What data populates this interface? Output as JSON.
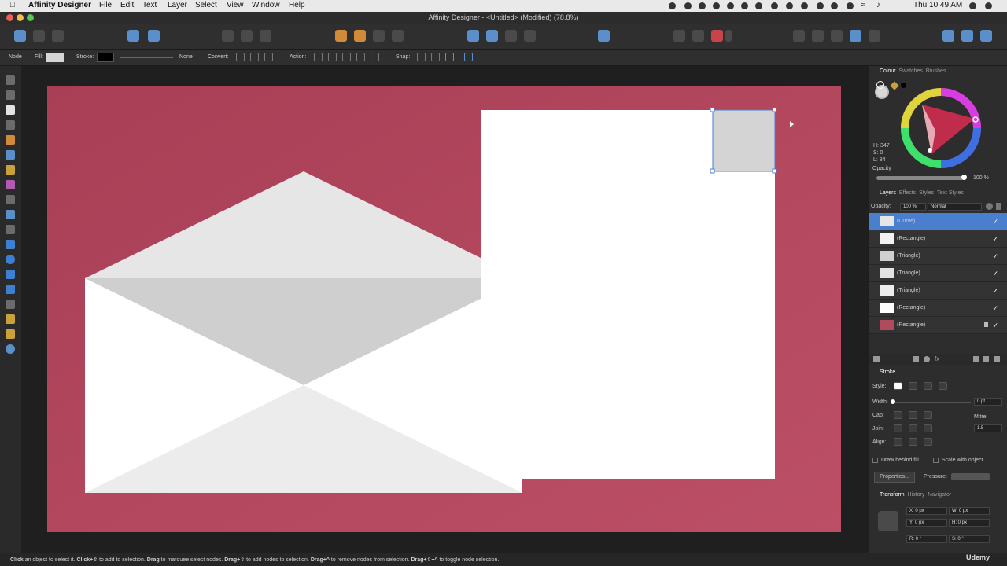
{
  "menubar": {
    "app_name": "Affinity Designer",
    "items": [
      "File",
      "Edit",
      "Text",
      "Layer",
      "Select",
      "View",
      "Window",
      "Help"
    ],
    "clock": "Thu 10:49 AM"
  },
  "window": {
    "title": "Affinity Designer - <Untitled> (Modified) (78.8%)"
  },
  "context_bar": {
    "mode": "Node",
    "fill_label": "Fill:",
    "stroke_label": "Stroke:",
    "stroke_value": "None",
    "convert_label": "Convert:",
    "action_label": "Action:",
    "snap_label": "Snap:"
  },
  "colour_panel": {
    "tabs": [
      "Colour",
      "Swatches",
      "Brushes"
    ],
    "h": "H: 347",
    "s": "S: 0",
    "l": "L: 84",
    "opacity_label": "Opacity",
    "opacity_value": "100 %"
  },
  "layers_panel": {
    "tabs": [
      "Layers",
      "Effects",
      "Styles",
      "Text Styles"
    ],
    "opacity_label": "Opacity:",
    "opacity_value": "100 %",
    "blend_mode": "Normal",
    "layers": [
      {
        "name": "(Curve)",
        "selected": true,
        "thumb": "#e6e6e6"
      },
      {
        "name": "(Rectangle)",
        "selected": false,
        "thumb": "#f2f2f2"
      },
      {
        "name": "(Triangle)",
        "selected": false,
        "thumb": "#d0d0d0"
      },
      {
        "name": "(Triangle)",
        "selected": false,
        "thumb": "#e2e2e2"
      },
      {
        "name": "(Triangle)",
        "selected": false,
        "thumb": "#ececec"
      },
      {
        "name": "(Rectangle)",
        "selected": false,
        "thumb": "#ffffff"
      },
      {
        "name": "(Rectangle)",
        "selected": false,
        "thumb": "#b04a5c",
        "locked": true
      }
    ]
  },
  "stroke_panel": {
    "title": "Stroke",
    "style_label": "Style:",
    "width_label": "Width:",
    "width_value": "0 pt",
    "cap_label": "Cap:",
    "join_label": "Join:",
    "mitre_label": "Mitre:",
    "mitre_value": "1.5",
    "align_label": "Align:",
    "draw_behind_fill": "Draw behind fill",
    "scale_with_object": "Scale with object",
    "properties_button": "Properties...",
    "pressure_label": "Pressure:"
  },
  "transform_panel": {
    "tabs": [
      "Transform",
      "History",
      "Navigator"
    ],
    "x": "X: 0 px",
    "y": "Y: 0 px",
    "w": "W: 0 px",
    "h": "H: 0 px",
    "r": "R: 0 °",
    "s": "S: 0 °"
  },
  "status_bar": {
    "b1": "Click",
    "t1": " an object to select it. ",
    "b2": "Click+⇧",
    "t2": " to add to selection. ",
    "b3": "Drag",
    "t3": " to marquee select nodes. ",
    "b4": "Drag+⇧",
    "t4": " to add nodes to selection. ",
    "b5": "Drag+^",
    "t5": " to remove nodes from selection. ",
    "b6": "Drag+⇧+^",
    "t6": " to toggle node selection."
  },
  "badge": {
    "udemy": "Udemy"
  },
  "colors": {
    "artboard": "#b0455a",
    "selection_blue": "#4a7fd0",
    "accent_square": "#d4d4d4"
  }
}
